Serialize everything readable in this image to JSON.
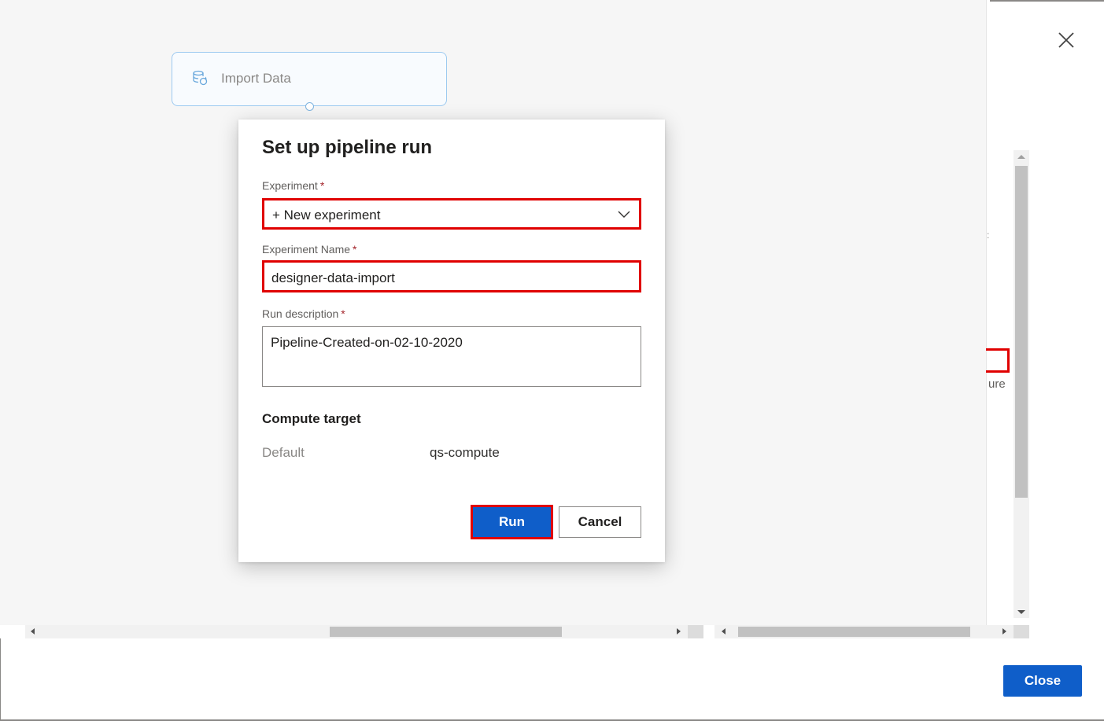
{
  "canvas": {
    "module": {
      "label": "Import Data",
      "icon": "database-refresh-icon"
    }
  },
  "panel": {
    "close_icon": "close-icon",
    "peek_text": "ure",
    "peek_dot": ":"
  },
  "dialog": {
    "title": "Set up pipeline run",
    "experiment": {
      "label": "Experiment",
      "required_mark": "*",
      "selected": "+ New experiment",
      "icon": "chevron-down-icon"
    },
    "experiment_name": {
      "label": "Experiment Name",
      "required_mark": "*",
      "value": "designer-data-import"
    },
    "run_description": {
      "label": "Run description",
      "required_mark": "*",
      "value": "Pipeline-Created-on-02-10-2020"
    },
    "compute_target": {
      "heading": "Compute target",
      "key": "Default",
      "value": "qs-compute"
    },
    "buttons": {
      "run": "Run",
      "cancel": "Cancel"
    }
  },
  "footer": {
    "close_label": "Close"
  },
  "colors": {
    "primary": "#0f5ec9",
    "highlight": "#e00000",
    "canvas_bg": "#f6f6f6",
    "module_border": "#9dcaf0"
  }
}
